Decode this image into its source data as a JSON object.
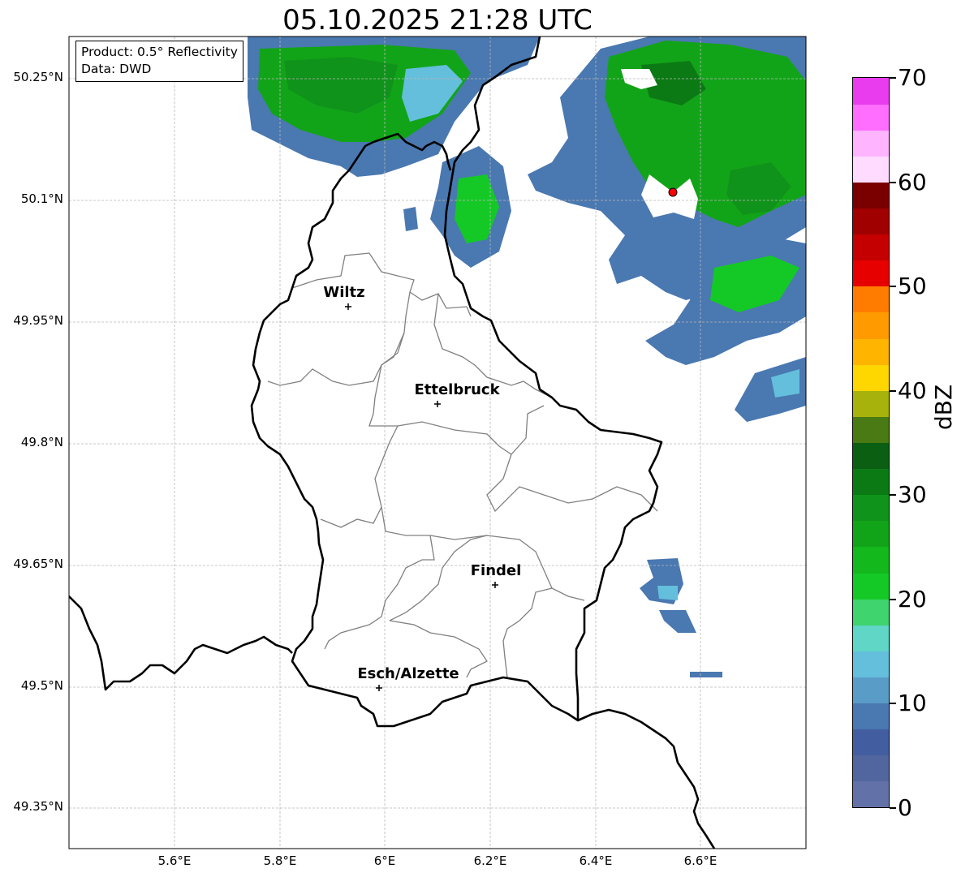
{
  "title": "05.10.2025 21:28 UTC",
  "info": {
    "product": "Product: 0.5° Reflectivity",
    "source": "Data: DWD"
  },
  "axes": {
    "lat_labels": [
      "50.25°N",
      "50.1°N",
      "49.95°N",
      "49.8°N",
      "49.65°N",
      "49.5°N",
      "49.35°N"
    ],
    "lon_labels": [
      "5.6°E",
      "5.8°E",
      "6°E",
      "6.2°E",
      "6.4°E",
      "6.6°E"
    ]
  },
  "cities": [
    {
      "name": "Wiltz"
    },
    {
      "name": "Ettelbruck"
    },
    {
      "name": "Findel"
    },
    {
      "name": "Esch/Alzette"
    }
  ],
  "colorbar": {
    "unit": "dBZ",
    "range": [
      0,
      70
    ],
    "tick_labels": [
      "0",
      "10",
      "20",
      "30",
      "40",
      "50",
      "60",
      "70"
    ],
    "colors": [
      "#6272a8",
      "#51669e",
      "#435ea0",
      "#4a78b0",
      "#5a9cc8",
      "#64bfdc",
      "#5fd6c6",
      "#3fd46e",
      "#14c926",
      "#13b81c",
      "#12a418",
      "#10931a",
      "#0c7a14",
      "#0a5f12",
      "#4a7a14",
      "#a8b20c",
      "#ffd700",
      "#ffb400",
      "#ff9b00",
      "#ff7c00",
      "#e60000",
      "#c40000",
      "#a00000",
      "#7a0000",
      "#ffdcff",
      "#ffb4ff",
      "#ff6eff",
      "#e83cee"
    ]
  },
  "colors": {
    "country_border": "#000000",
    "canton_border": "#808080",
    "radar_site": "#ff0000"
  }
}
